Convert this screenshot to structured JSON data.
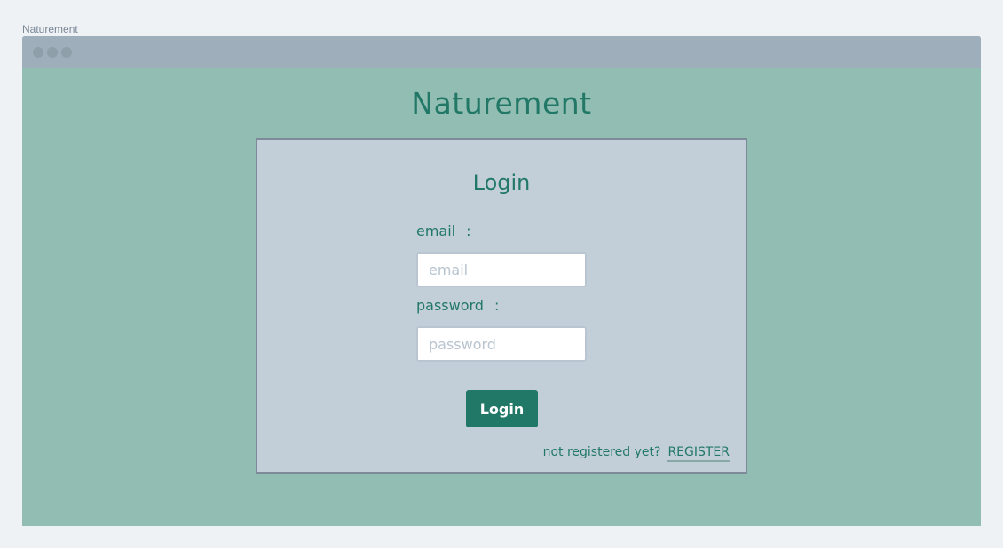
{
  "window": {
    "label": "Naturement"
  },
  "header": {
    "site_title": "Naturement"
  },
  "login_card": {
    "title": "Login",
    "email_label": "email",
    "email_colon": ":",
    "email_placeholder": "email",
    "email_value": "",
    "password_label": "password",
    "password_colon": ":",
    "password_placeholder": "password",
    "password_value": "",
    "login_button": "Login",
    "not_registered_text": "not registered yet?",
    "register_link": "REGISTER"
  },
  "colors": {
    "page_background": "#eff2f5",
    "browser_background": "#92bdb2",
    "titlebar": "#9eaebb",
    "card_background": "#c3cfd8",
    "accent": "#217867"
  }
}
